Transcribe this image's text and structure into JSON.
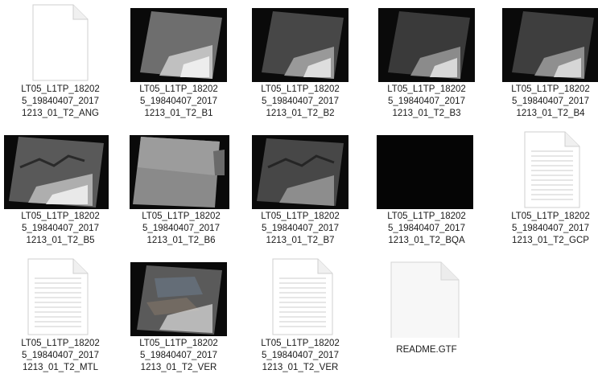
{
  "files": [
    {
      "label": "LT05_L1TP_18202\n5_19840407_2017\n1213_01_T2_ANG",
      "icon": "text-document-icon"
    },
    {
      "label": "LT05_L1TP_18202\n5_19840407_2017\n1213_01_T2_B1",
      "icon": "satellite-image-icon"
    },
    {
      "label": "LT05_L1TP_18202\n5_19840407_2017\n1213_01_T2_B2",
      "icon": "satellite-image-icon"
    },
    {
      "label": "LT05_L1TP_18202\n5_19840407_2017\n1213_01_T2_B3",
      "icon": "satellite-image-icon"
    },
    {
      "label": "LT05_L1TP_18202\n5_19840407_2017\n1213_01_T2_B4",
      "icon": "satellite-image-icon"
    },
    {
      "label": "LT05_L1TP_18202\n5_19840407_2017\n1213_01_T2_B5",
      "icon": "satellite-image-icon"
    },
    {
      "label": "LT05_L1TP_18202\n5_19840407_2017\n1213_01_T2_B6",
      "icon": "satellite-image-icon"
    },
    {
      "label": "LT05_L1TP_18202\n5_19840407_2017\n1213_01_T2_B7",
      "icon": "satellite-image-icon"
    },
    {
      "label": "LT05_L1TP_18202\n5_19840407_2017\n1213_01_T2_BQA",
      "icon": "satellite-image-icon"
    },
    {
      "label": "LT05_L1TP_18202\n5_19840407_2017\n1213_01_T2_GCP",
      "icon": "text-document-icon"
    },
    {
      "label": "LT05_L1TP_18202\n5_19840407_2017\n1213_01_T2_MTL",
      "icon": "text-document-icon"
    },
    {
      "label": "LT05_L1TP_18202\n5_19840407_2017\n1213_01_T2_VER",
      "icon": "satellite-image-icon"
    },
    {
      "label": "LT05_L1TP_18202\n5_19840407_2017\n1213_01_T2_VER",
      "icon": "text-document-icon"
    },
    {
      "label": "README.GTF",
      "icon": "blank-file-icon"
    }
  ]
}
